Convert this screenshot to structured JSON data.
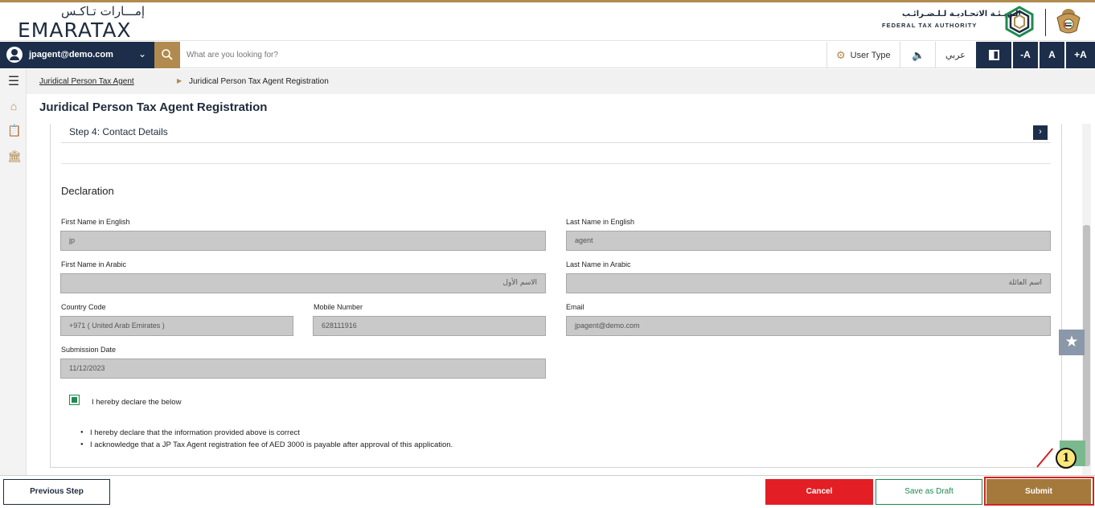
{
  "brand": {
    "logo_arabic": "إمـــارات تـاكـس",
    "logo_english": "EMARATAX",
    "authority_arabic": "الـهيـئـة الاتحـاديـة لـلـضـرائـب",
    "authority_english": "FEDERAL TAX AUTHORITY"
  },
  "nav": {
    "user_email": "jpagent@demo.com",
    "search_placeholder": "What are you looking for?",
    "user_type_label": "User Type",
    "language_label": "عربي",
    "font_decrease": "-A",
    "font_normal": "A",
    "font_increase": "+A"
  },
  "breadcrumb": {
    "parent": "Juridical Person Tax Agent",
    "current": "Juridical Person Tax Agent Registration"
  },
  "page": {
    "title": "Juridical Person Tax Agent Registration",
    "step_title": "Step 4: Contact Details"
  },
  "declaration": {
    "title": "Declaration",
    "first_name_en_label": "First Name in English",
    "first_name_en_value": "jp",
    "last_name_en_label": "Last Name in English",
    "last_name_en_value": "agent",
    "first_name_ar_label": "First Name in Arabic",
    "first_name_ar_value": "الاسم الأول",
    "last_name_ar_label": "Last Name in Arabic",
    "last_name_ar_value": "اسم العائلة",
    "country_code_label": "Country Code",
    "country_code_value": "+971 ( United Arab Emirates )",
    "mobile_label": "Mobile Number",
    "mobile_value": "628111916",
    "email_label": "Email",
    "email_value": "jpagent@demo.com",
    "submission_date_label": "Submission Date",
    "submission_date_value": "11/12/2023",
    "checkbox_label": "I hereby declare the below",
    "checkbox_checked": true,
    "bullets": [
      "I hereby declare that the information provided above is correct",
      "I acknowledge that a JP Tax Agent registration fee of AED 3000 is payable after approval of this application."
    ]
  },
  "actions": {
    "previous": "Previous Step",
    "cancel": "Cancel",
    "save_draft": "Save as Draft",
    "submit": "Submit"
  },
  "annotation": {
    "step_number": "1"
  },
  "colors": {
    "navy": "#1c2e4a",
    "gold": "#b08a4f",
    "submit_gold": "#a5793c",
    "cancel_red": "#e31e24",
    "green": "#1d8a4f"
  }
}
